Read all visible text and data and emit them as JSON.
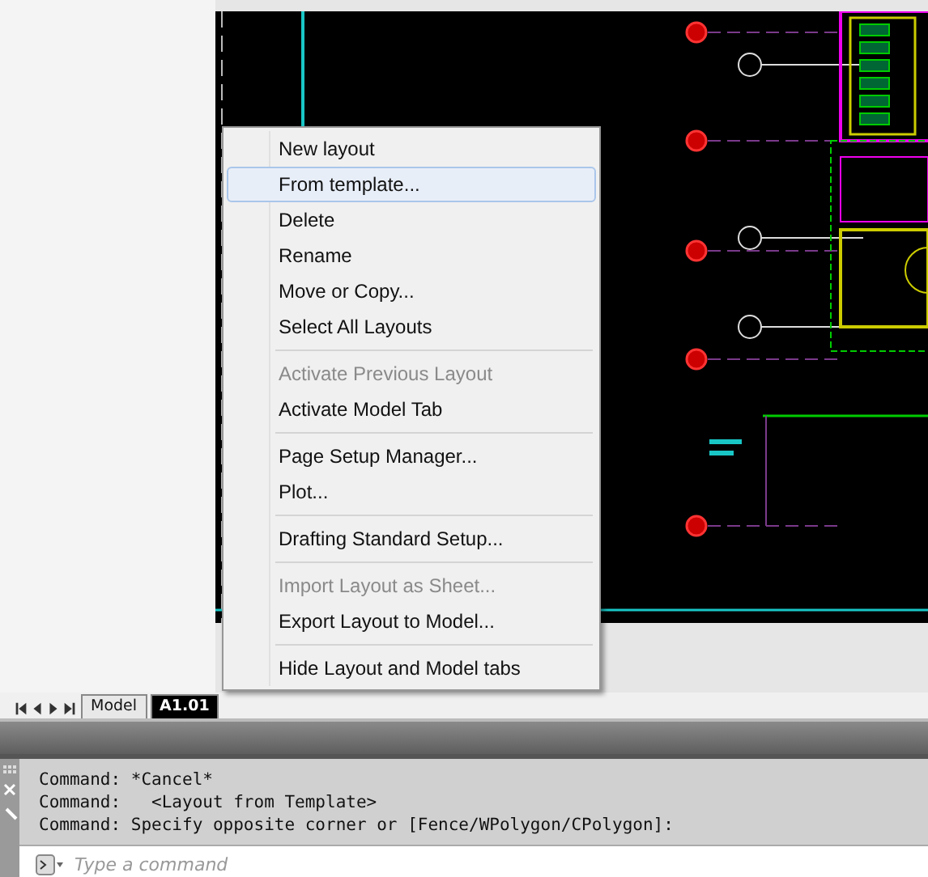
{
  "layout_tabs": [
    {
      "label": "Model",
      "selected": false
    },
    {
      "label": "A1.01",
      "selected": true
    }
  ],
  "context_menu": [
    {
      "kind": "item",
      "label": "New layout",
      "disabled": false,
      "selected": false
    },
    {
      "kind": "item",
      "label": "From template...",
      "disabled": false,
      "selected": true
    },
    {
      "kind": "item",
      "label": "Delete",
      "disabled": false,
      "selected": false
    },
    {
      "kind": "item",
      "label": "Rename",
      "disabled": false,
      "selected": false
    },
    {
      "kind": "item",
      "label": "Move or Copy...",
      "disabled": false,
      "selected": false
    },
    {
      "kind": "item",
      "label": "Select All Layouts",
      "disabled": false,
      "selected": false
    },
    {
      "kind": "separator"
    },
    {
      "kind": "item",
      "label": "Activate Previous Layout",
      "disabled": true,
      "selected": false
    },
    {
      "kind": "item",
      "label": "Activate Model Tab",
      "disabled": false,
      "selected": false
    },
    {
      "kind": "separator"
    },
    {
      "kind": "item",
      "label": "Page Setup Manager...",
      "disabled": false,
      "selected": false
    },
    {
      "kind": "item",
      "label": "Plot...",
      "disabled": false,
      "selected": false
    },
    {
      "kind": "separator"
    },
    {
      "kind": "item",
      "label": "Drafting Standard Setup...",
      "disabled": false,
      "selected": false
    },
    {
      "kind": "separator"
    },
    {
      "kind": "item",
      "label": "Import Layout as Sheet...",
      "disabled": true,
      "selected": false
    },
    {
      "kind": "item",
      "label": "Export Layout to Model...",
      "disabled": false,
      "selected": false
    },
    {
      "kind": "separator"
    },
    {
      "kind": "item",
      "label": "Hide Layout and Model tabs",
      "disabled": false,
      "selected": false
    }
  ],
  "command_history": [
    "Command: *Cancel*",
    "Command:   <Layout from Template>",
    "Command: Specify opposite corner or [Fence/WPolygon/CPolygon]:"
  ],
  "command_input": {
    "placeholder": "Type a command"
  }
}
